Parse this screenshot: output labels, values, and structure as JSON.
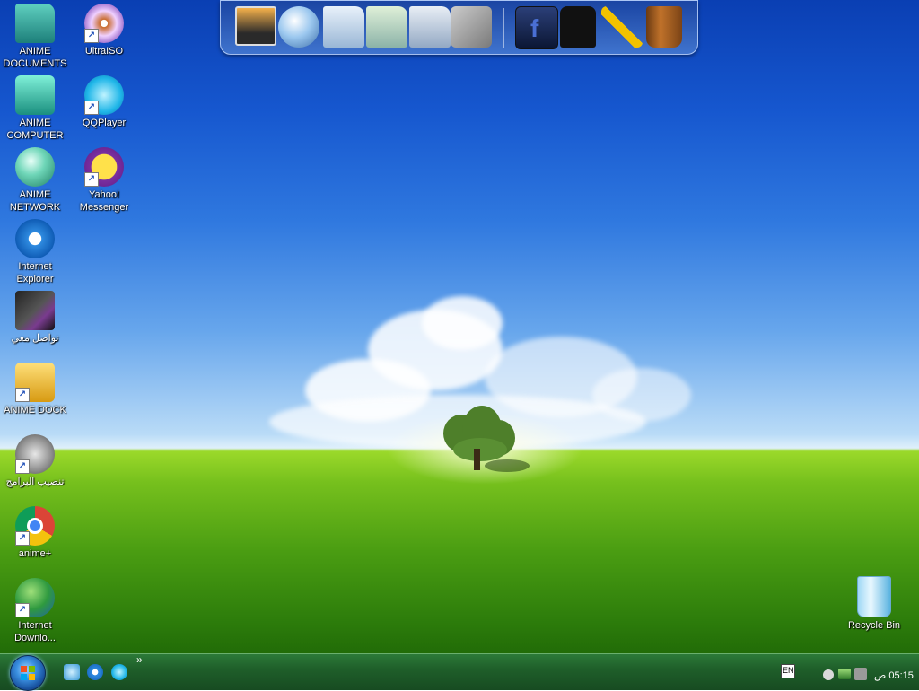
{
  "desktop": {
    "icons": [
      {
        "label": "ANIME\nDOCUMENTS",
        "icon": "folder-icon"
      },
      {
        "label": "UltraISO",
        "icon": "disc-icon"
      },
      {
        "label": "ANIME\nCOMPUTER",
        "icon": "computer-icon"
      },
      {
        "label": "QQPlayer",
        "icon": "media-player-icon"
      },
      {
        "label": "ANIME\nNETWORK",
        "icon": "network-globe-icon"
      },
      {
        "label": "Yahoo!\nMessenger",
        "icon": "yahoo-messenger-icon"
      },
      {
        "label": "Internet\nExplorer",
        "icon": "internet-explorer-icon"
      },
      {
        "label": "تواصل معي",
        "icon": "dark-folder-icon"
      },
      {
        "label": "ANIME DOCK",
        "icon": "rocketdock-icon"
      },
      {
        "label": "تنصيب البرامج",
        "icon": "installer-icon"
      },
      {
        "label": "anime+",
        "icon": "chrome-icon"
      },
      {
        "label": "Internet\nDownlo...",
        "icon": "download-manager-icon"
      },
      {
        "label": "Recycle Bin",
        "icon": "recycle-bin-icon"
      }
    ]
  },
  "dock": {
    "items": [
      "anime-character-monitor-icon",
      "network-globe-icon",
      "documents-folder-icon",
      "music-folder-icon",
      "pictures-folder-icon",
      "tools-icon",
      "facebook-icon",
      "tshirt-icon",
      "tools-hammer-icon",
      "wooden-bucket-icon"
    ]
  },
  "taskbar": {
    "quicklaunch_more": "»",
    "language": "EN",
    "clock": "05:15 ص"
  },
  "colors": {
    "taskbar": "#1f5f2a",
    "sky_top": "#0a3fb3",
    "grass": "#4a9d12"
  }
}
